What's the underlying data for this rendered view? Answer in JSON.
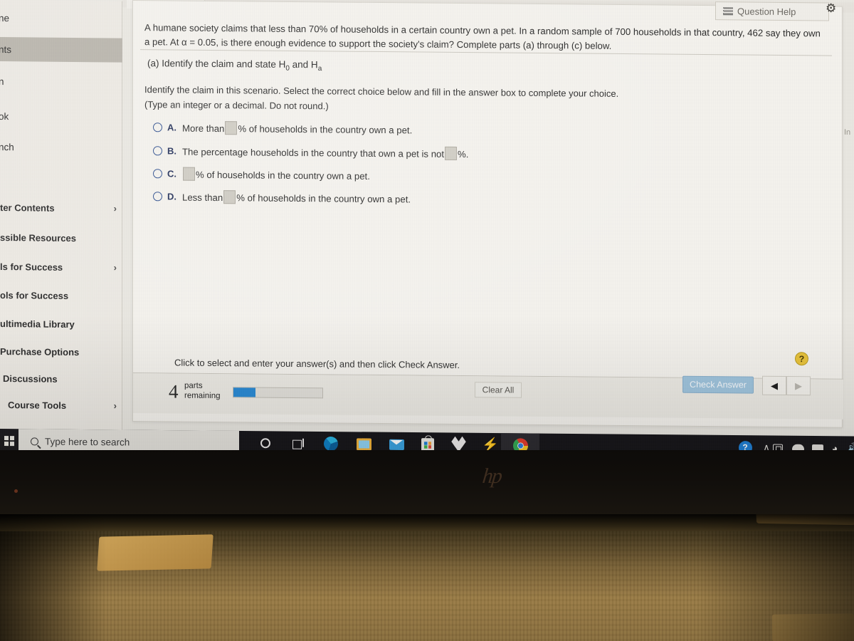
{
  "sidebar": {
    "items": [
      {
        "label": "ne",
        "chevron": false,
        "highlight": false
      },
      {
        "label": "nts",
        "chevron": false,
        "highlight": true
      },
      {
        "label": "n",
        "chevron": false,
        "highlight": false
      },
      {
        "label": "ok",
        "chevron": false,
        "highlight": false
      },
      {
        "label": "nch",
        "chevron": false,
        "highlight": false
      },
      {
        "label": "ter Contents",
        "chevron": true,
        "highlight": false
      },
      {
        "label": "ssible Resources",
        "chevron": false,
        "highlight": false
      },
      {
        "label": "ls for Success",
        "chevron": true,
        "highlight": false
      },
      {
        "label": "ols for Success",
        "chevron": false,
        "highlight": false
      },
      {
        "label": "ultimedia Library",
        "chevron": false,
        "highlight": false
      },
      {
        "label": "Purchase Options",
        "chevron": false,
        "highlight": false
      },
      {
        "label": "Discussions",
        "chevron": false,
        "highlight": false
      },
      {
        "label": "Course Tools",
        "chevron": true,
        "highlight": false
      }
    ],
    "chevron_glyph": "›"
  },
  "exercise": {
    "question_help_label": "Question Help",
    "gear_glyph": "⚙",
    "stem": "A humane society claims that less than 70% of households in a certain country own a pet. In a random sample of 700 households in that country, 462 say they own a pet. At α = 0.05, is there enough evidence to support the society's claim? Complete parts (a) through (c) below.",
    "part_label_prefix": "(a) Identify the claim and state H",
    "part_label_sub1": "0",
    "part_label_mid": " and H",
    "part_label_sub2": "a",
    "instruction_line1": "Identify the claim in this scenario. Select the correct choice below and fill in the answer box to complete your choice.",
    "instruction_line2": "(Type an integer or a decimal. Do not round.)",
    "choices": [
      {
        "letter": "A.",
        "pre": "More than",
        "post": "% of households in the country own a pet.",
        "box_first": false,
        "selected": false
      },
      {
        "letter": "B.",
        "pre": "The percentage households in the country that own a pet is not",
        "post": "%.",
        "box_first": false,
        "selected": false
      },
      {
        "letter": "C.",
        "pre": "",
        "post": "% of households in the country own a pet.",
        "box_first": true,
        "selected": false
      },
      {
        "letter": "D.",
        "pre": "Less than",
        "post": "% of households in the country own a pet.",
        "box_first": false,
        "selected": false
      }
    ],
    "hint_badge": "?",
    "tip_text": "Click to select and enter your answer(s) and then click Check Answer.",
    "parts_remaining_count": "4",
    "parts_remaining_line1": "parts",
    "parts_remaining_line2": "remaining",
    "progress_percent": 25,
    "clear_all_label": "Clear All",
    "check_answer_label": "Check Answer",
    "nav_prev_glyph": "◀",
    "nav_next_glyph": "▶",
    "right_edge_text": "In"
  },
  "taskbar": {
    "search_placeholder": "Type here to search",
    "icons": [
      {
        "name": "cortana-icon",
        "label": "Cortana"
      },
      {
        "name": "task-view-icon",
        "label": "Task View"
      },
      {
        "name": "edge-icon",
        "label": "Microsoft Edge"
      },
      {
        "name": "file-explorer-icon",
        "label": "File Explorer"
      },
      {
        "name": "mail-icon",
        "label": "Mail"
      },
      {
        "name": "microsoft-store-icon",
        "label": "Microsoft Store"
      },
      {
        "name": "dropbox-icon",
        "label": "Dropbox"
      },
      {
        "name": "lightning-icon",
        "label": "Lightning"
      },
      {
        "name": "chrome-icon",
        "label": "Google Chrome"
      }
    ],
    "tray": {
      "help_glyph": "?",
      "chevron_glyph": "∧",
      "wifi_glyph": "◠",
      "speaker_glyph": "◂"
    }
  },
  "device": {
    "brand_logo": "hp"
  },
  "colors": {
    "accent_blue": "#2b8ad4",
    "check_button": "#9fc4dd",
    "radio_blue": "#2f4f8f",
    "hint_yellow": "#e8c33b",
    "panel_bg": "#f4f2ed",
    "sidebar_bg": "#ece9e3",
    "highlight_gray": "#b8b4ab",
    "taskbar_dark": "#17161a"
  }
}
